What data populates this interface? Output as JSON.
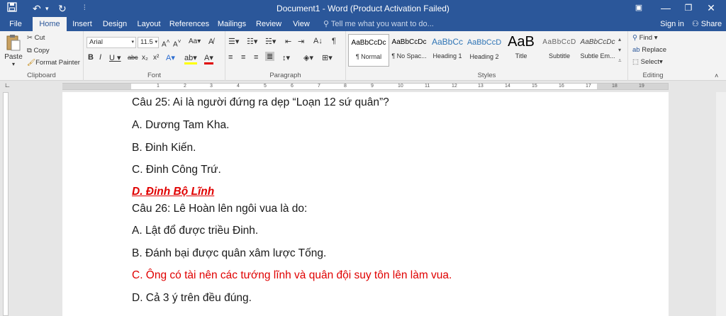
{
  "titlebar": {
    "title": "Document1 - Word (Product Activation Failed)",
    "save_icon": "save-icon",
    "undo_icon": "undo-icon",
    "redo_icon": "redo-icon"
  },
  "tabs": [
    "File",
    "Home",
    "Insert",
    "Design",
    "Layout",
    "References",
    "Mailings",
    "Review",
    "View"
  ],
  "tell_me": "Tell me what you want to do...",
  "sign_in": "Sign in",
  "share": "Share",
  "clipboard": {
    "paste": "Paste",
    "cut": "Cut",
    "copy": "Copy",
    "format_painter": "Format Painter",
    "label": "Clipboard"
  },
  "font": {
    "name": "Arial",
    "size": "11.5",
    "label": "Font"
  },
  "paragraph": {
    "label": "Paragraph"
  },
  "styles": {
    "items": [
      {
        "sample": "AaBbCcDc",
        "name": "¶ Normal"
      },
      {
        "sample": "AaBbCcDc",
        "name": "¶ No Spac..."
      },
      {
        "sample": "AaBbCc",
        "name": "Heading 1"
      },
      {
        "sample": "AaBbCcD",
        "name": "Heading 2"
      },
      {
        "sample": "AaB",
        "name": "Title"
      },
      {
        "sample": "AaBbCcD",
        "name": "Subtitle"
      },
      {
        "sample": "AaBbCcDc",
        "name": "Subtle Em..."
      }
    ],
    "label": "Styles"
  },
  "editing": {
    "find": "Find",
    "replace": "Replace",
    "select": "Select",
    "label": "Editing"
  },
  "ruler_numbers": [
    "1",
    "2",
    "3",
    "4",
    "5",
    "6",
    "7",
    "8",
    "9",
    "10",
    "11",
    "12",
    "13",
    "14",
    "15",
    "16",
    "17",
    "18",
    "19"
  ],
  "document": {
    "lines": [
      "Câu 25: Ai là người đứng ra dẹp “Loạn 12 sứ quân”?",
      "A. Dương Tam Kha.",
      "B. Đinh Kiến.",
      "C. Đinh Công Trứ.",
      "D. Đinh Bộ Lĩnh",
      "Câu 26: Lê Hoàn lên ngôi vua là do:",
      "A. Lật đổ được triều Đinh.",
      "B. Đánh bại được quân xâm lược Tống.",
      "C. Ông có tài nên các tướng lĩnh và quân đội suy tôn lên làm vua.",
      "D. Cả 3 ý trên đều đúng."
    ]
  },
  "colors": {
    "title_bar": "#2b579a",
    "ribbon": "#f3f3f3",
    "answer_red": "#e00000"
  }
}
